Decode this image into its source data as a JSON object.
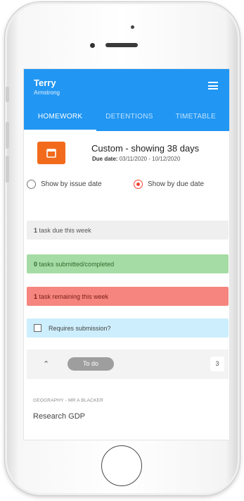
{
  "user": {
    "first_name": "Terry",
    "last_name": "Armstrong"
  },
  "tabs": [
    {
      "label": "HOMEWORK",
      "active": true
    },
    {
      "label": "DETENTIONS",
      "active": false
    },
    {
      "label": "TIMETABLE",
      "active": false
    }
  ],
  "filter": {
    "title": "Custom - showing 38 days",
    "due_label": "Due date:",
    "due_range": "03/11/2020 - 10/12/2020"
  },
  "radios": [
    {
      "label": "Show by issue date",
      "selected": false
    },
    {
      "label": "Show by due date",
      "selected": true
    }
  ],
  "summary": {
    "week_count": "1",
    "week_text": "task due this week",
    "done_count": "0",
    "done_text": "tasks submitted/completed",
    "remain_count": "1",
    "remain_text": "task remaining this week",
    "requires_submission": "Requires submission?"
  },
  "todo": {
    "label": "To do",
    "count": "3"
  },
  "task": {
    "subject": "GEOGRAPHY - MR A BLACKER",
    "title": "Research GDP"
  },
  "colors": {
    "app_bar": "#2196f3",
    "calendar_button": "#f26a1b",
    "completed_bar": "#a5dca5",
    "remaining_bar": "#f5857e",
    "submission_bar": "#cdeefc",
    "radio_selected": "#f44336"
  },
  "icons": [
    "menu-icon",
    "calendar-icon",
    "chevron-up-icon",
    "checkbox-icon"
  ]
}
